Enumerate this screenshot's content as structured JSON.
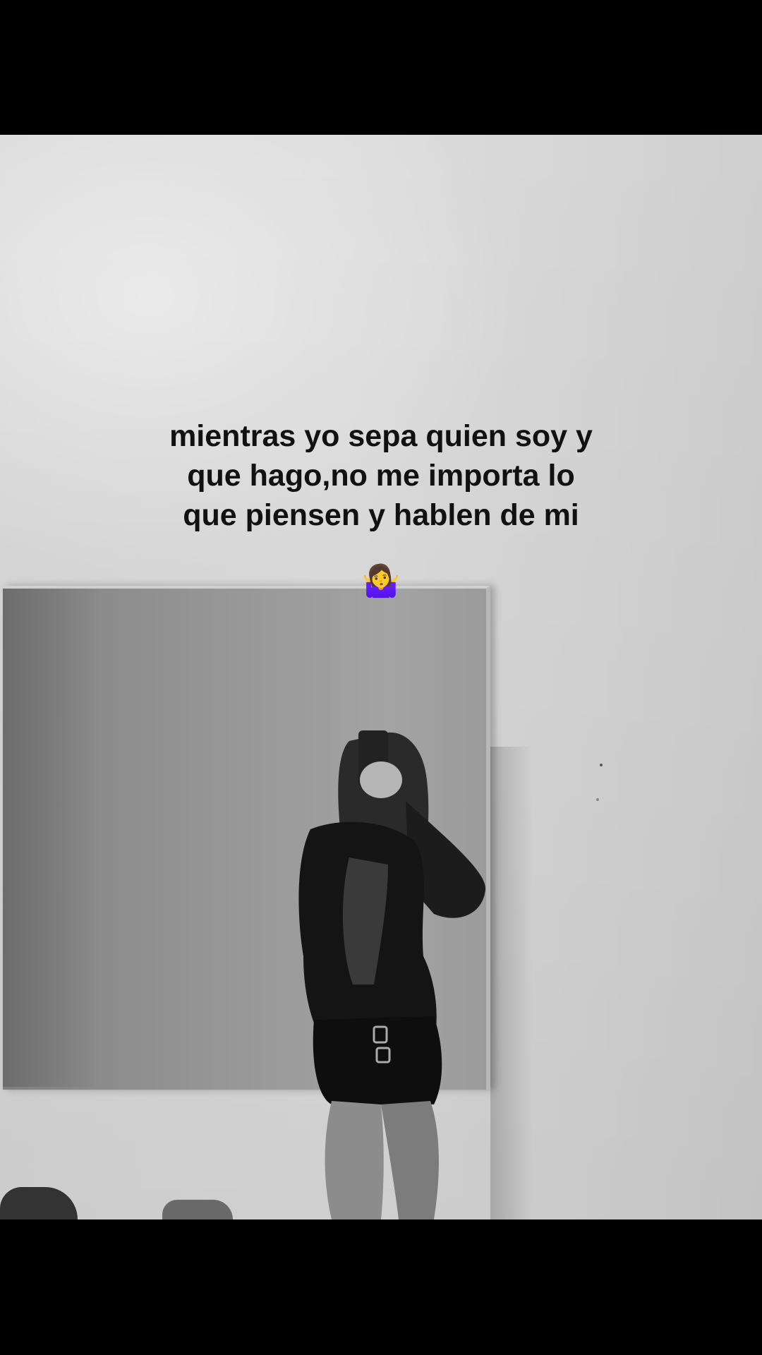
{
  "caption": {
    "line1": "mientras yo sepa quien soy y",
    "line2": "que hago,no me importa lo",
    "line3": "que piensen y hablen de mi",
    "emoji": "🤷‍♀️"
  },
  "colors": {
    "letterbox": "#000000",
    "wall": "#dddddd",
    "caption_text": "#111111",
    "emoji_accent": "#7b3fa0"
  },
  "icons": {
    "shrug": "woman-shrugging-emoji"
  }
}
